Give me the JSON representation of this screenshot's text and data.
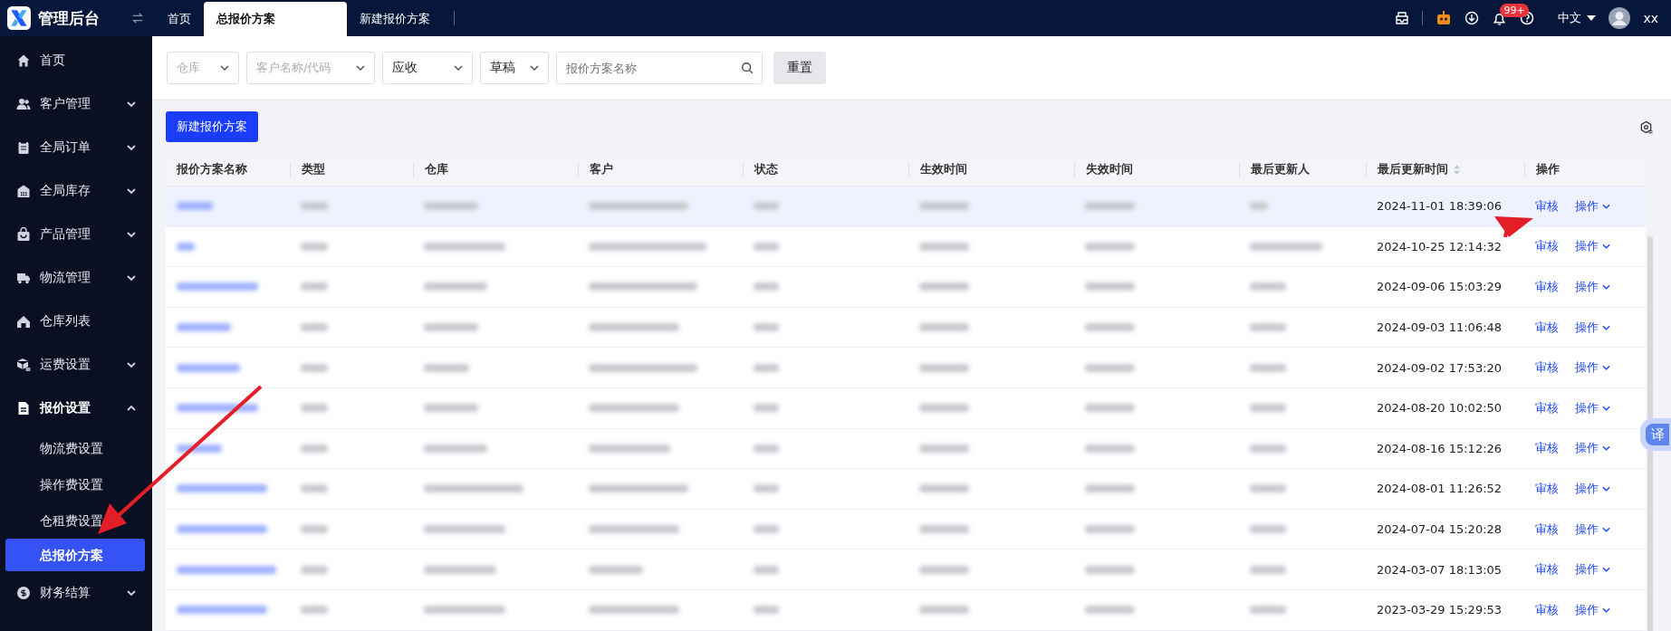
{
  "app": {
    "title": "管理后台"
  },
  "tabs": [
    {
      "label": "首页",
      "selected": false
    },
    {
      "label": "总报价方案",
      "selected": true
    },
    {
      "label": "新建报价方案",
      "selected": false
    }
  ],
  "header": {
    "notification_count": "99+",
    "language": "中文",
    "user": "xx"
  },
  "sidebar": {
    "items": [
      {
        "label": "首页",
        "expandable": false
      },
      {
        "label": "客户管理",
        "expandable": true,
        "expanded": false
      },
      {
        "label": "全局订单",
        "expandable": true,
        "expanded": false
      },
      {
        "label": "全局库存",
        "expandable": true,
        "expanded": false
      },
      {
        "label": "产品管理",
        "expandable": true,
        "expanded": false
      },
      {
        "label": "物流管理",
        "expandable": true,
        "expanded": false
      },
      {
        "label": "仓库列表",
        "expandable": false
      },
      {
        "label": "运费设置",
        "expandable": true,
        "expanded": false
      },
      {
        "label": "报价设置",
        "expandable": true,
        "expanded": true,
        "children": [
          {
            "label": "物流费设置",
            "selected": false
          },
          {
            "label": "操作费设置",
            "selected": false
          },
          {
            "label": "仓租费设置",
            "selected": false
          },
          {
            "label": "总报价方案",
            "selected": true
          }
        ]
      },
      {
        "label": "财务结算",
        "expandable": true,
        "expanded": false
      }
    ]
  },
  "filters": [
    {
      "kind": "select",
      "placeholder": "仓库"
    },
    {
      "kind": "select",
      "placeholder": "客户名称/代码"
    },
    {
      "kind": "select",
      "value": "应收"
    },
    {
      "kind": "select",
      "value": "草稿"
    },
    {
      "kind": "search",
      "placeholder": "报价方案名称"
    }
  ],
  "reset_button": "重置",
  "new_button": "新建报价方案",
  "table": {
    "columns": [
      {
        "label": "报价方案名称",
        "sortable": false
      },
      {
        "label": "类型",
        "sortable": false
      },
      {
        "label": "仓库",
        "sortable": false
      },
      {
        "label": "客户",
        "sortable": false
      },
      {
        "label": "状态",
        "sortable": false
      },
      {
        "label": "生效时间",
        "sortable": false
      },
      {
        "label": "失效时间",
        "sortable": false
      },
      {
        "label": "最后更新人",
        "sortable": false
      },
      {
        "label": "最后更新时间",
        "sortable": true
      },
      {
        "label": "操作",
        "sortable": false
      }
    ],
    "rows": [
      {
        "selected": true,
        "updated_at": "2024-11-01 18:39:06",
        "review": "审核",
        "more": "操作"
      },
      {
        "selected": false,
        "updated_at": "2024-10-25 12:14:32",
        "review": "审核",
        "more": "操作"
      },
      {
        "selected": false,
        "updated_at": "2024-09-06 15:03:29",
        "review": "审核",
        "more": "操作"
      },
      {
        "selected": false,
        "updated_at": "2024-09-03 11:06:48",
        "review": "审核",
        "more": "操作"
      },
      {
        "selected": false,
        "updated_at": "2024-09-02 17:53:20",
        "review": "审核",
        "more": "操作"
      },
      {
        "selected": false,
        "updated_at": "2024-08-20 10:02:50",
        "review": "审核",
        "more": "操作"
      },
      {
        "selected": false,
        "updated_at": "2024-08-16 15:12:26",
        "review": "审核",
        "more": "操作"
      },
      {
        "selected": false,
        "updated_at": "2024-08-01 11:26:52",
        "review": "审核",
        "more": "操作"
      },
      {
        "selected": false,
        "updated_at": "2024-07-04 15:20:28",
        "review": "审核",
        "more": "操作"
      },
      {
        "selected": false,
        "updated_at": "2024-03-07 18:13:05",
        "review": "审核",
        "more": "操作"
      },
      {
        "selected": false,
        "updated_at": "2023-03-29 15:29:53",
        "review": "审核",
        "more": "操作"
      }
    ]
  },
  "translate_button": "译"
}
